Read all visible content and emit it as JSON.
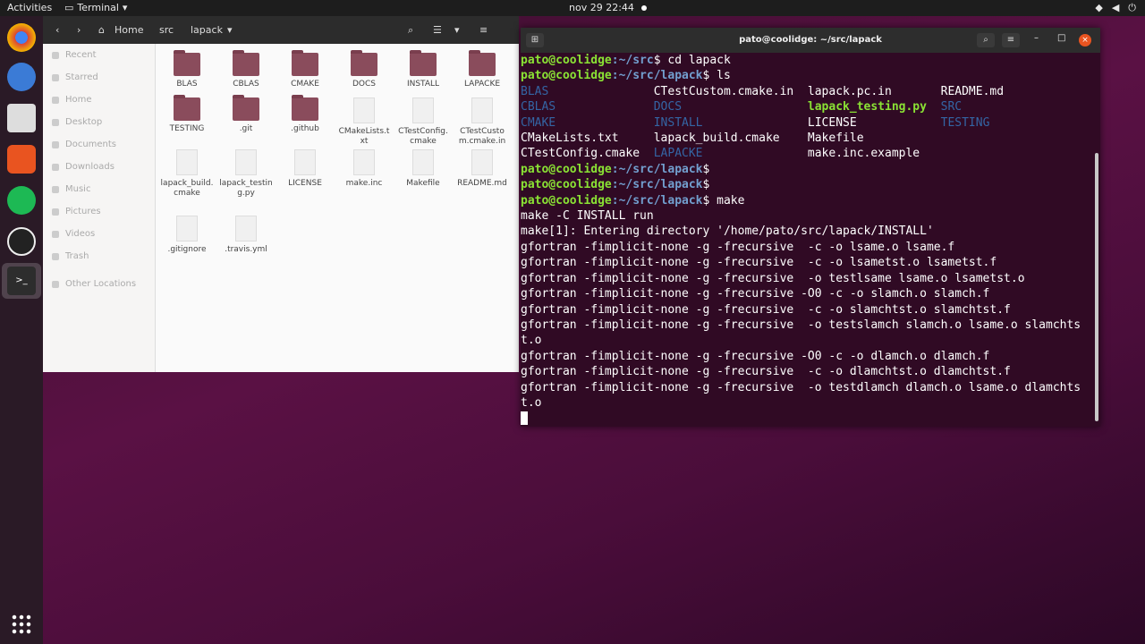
{
  "topbar": {
    "activities": "Activities",
    "app": "Terminal",
    "clock": "nov 29  22:44"
  },
  "files": {
    "breadcrumb": [
      "Home",
      "src",
      "lapack"
    ],
    "sidebar": [
      "Recent",
      "Starred",
      "Home",
      "Desktop",
      "Documents",
      "Downloads",
      "Music",
      "Pictures",
      "Videos",
      "Trash",
      "Other Locations"
    ],
    "items": [
      "BLAS",
      "CBLAS",
      "CMAKE",
      "DOCS",
      "INSTALL",
      "LAPACKE",
      "TESTING",
      ".git",
      ".github",
      "CMakeLists.txt",
      "CTestConfig.cmake",
      "CTestCustom.cmake.in",
      "lapack_build.cmake",
      "lapack_testing.py",
      "LICENSE",
      "make.inc",
      "Makefile",
      "README.md",
      ".gitignore",
      ".travis.yml"
    ]
  },
  "terminal": {
    "title": "pato@coolidge: ~/src/lapack",
    "prompt_user": "pato@coolidge",
    "p1": ":~/src",
    "p2": ":~/src/lapack",
    "cmd1": "$ cd lapack",
    "cmd2": "$ ls",
    "cmd3": "$",
    "cmd4": "$ make",
    "ls": [
      [
        "BLAS",
        "CTestCustom.cmake.in",
        "lapack.pc.in",
        "README.md"
      ],
      [
        "CBLAS",
        "DOCS",
        "lapack_testing.py",
        "SRC"
      ],
      [
        "CMAKE",
        "INSTALL",
        "LICENSE",
        "TESTING"
      ],
      [
        "CMakeLists.txt",
        "lapack_build.cmake",
        "Makefile",
        ""
      ],
      [
        "CTestConfig.cmake",
        "LAPACKE",
        "make.inc.example",
        ""
      ]
    ],
    "out": [
      "make -C INSTALL run",
      "make[1]: Entering directory '/home/pato/src/lapack/INSTALL'",
      "gfortran -fimplicit-none -g -frecursive  -c -o lsame.o lsame.f",
      "gfortran -fimplicit-none -g -frecursive  -c -o lsametst.o lsametst.f",
      "gfortran -fimplicit-none -g -frecursive  -o testlsame lsame.o lsametst.o",
      "gfortran -fimplicit-none -g -frecursive -O0 -c -o slamch.o slamch.f",
      "gfortran -fimplicit-none -g -frecursive  -c -o slamchtst.o slamchtst.f",
      "gfortran -fimplicit-none -g -frecursive  -o testslamch slamch.o lsame.o slamchts",
      "t.o",
      "gfortran -fimplicit-none -g -frecursive -O0 -c -o dlamch.o dlamch.f",
      "gfortran -fimplicit-none -g -frecursive  -c -o dlamchtst.o dlamchtst.f",
      "gfortran -fimplicit-none -g -frecursive  -o testdlamch dlamch.o lsame.o dlamchts",
      "t.o"
    ]
  }
}
